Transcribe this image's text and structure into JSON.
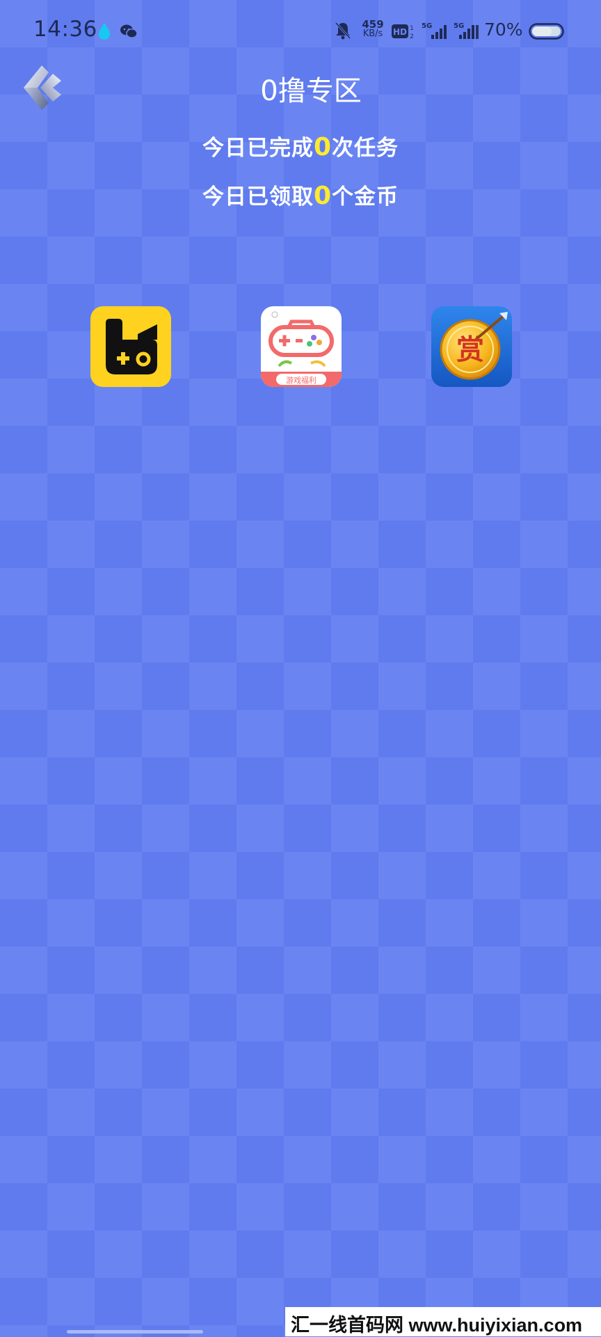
{
  "status_bar": {
    "time": "14:36",
    "net_speed": "459",
    "net_speed_unit": "KB/s",
    "hd_label": "HD",
    "sig1_label": "5G",
    "sig2_label": "5G",
    "battery_percent": "70%",
    "icons": [
      "water-drop-icon",
      "wechat-icon",
      "bell-muted-icon",
      "hd-voice-icon",
      "signal-icon",
      "battery-icon"
    ]
  },
  "header": {
    "title": "0撸专区",
    "back_icon": "back-arrow-icon"
  },
  "stats": {
    "tasks_prefix": "今日已完成",
    "tasks_count": "0",
    "tasks_suffix": "次任务",
    "coins_prefix": "今日已领取",
    "coins_count": "0",
    "coins_suffix": "个金币"
  },
  "apps": [
    {
      "icon": "game-controller-app-icon",
      "color": "#ffd21f"
    },
    {
      "icon": "gamepad-welfare-app-icon",
      "label": "游戏福利",
      "color": "#f26a6a"
    },
    {
      "icon": "reward-coin-app-icon",
      "label": "赏",
      "color": "#1f6fd8"
    }
  ],
  "watermark": {
    "cn_text": "汇一线首码网",
    "url_text": "www.huiyixian.com"
  },
  "colors": {
    "background": "#6a85f2",
    "highlight": "#ffea2e",
    "text": "#ffffff"
  }
}
